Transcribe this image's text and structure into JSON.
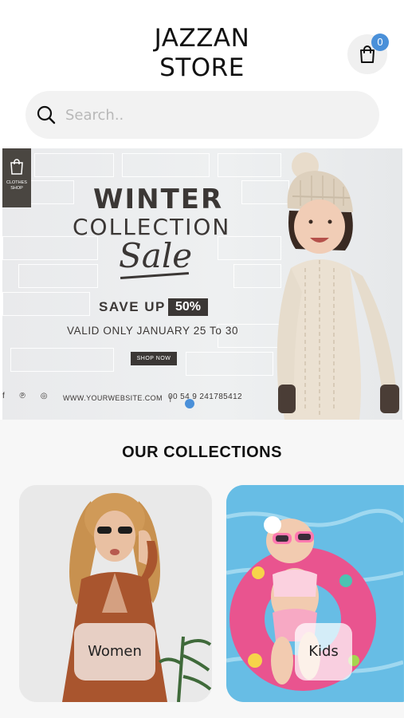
{
  "header": {
    "title_line1": "JAZZAN",
    "title_line2": "STORE",
    "cart_count": "0",
    "cart_icon": "shopping-bag-icon",
    "badge_color": "#4a90d9"
  },
  "search": {
    "placeholder": "Search..",
    "icon": "search-icon"
  },
  "banner": {
    "badge_text_line1": "CLOTHES",
    "badge_text_line2": "SHOP",
    "headline": "WINTER",
    "subheadline": "COLLECTION",
    "script_text": "Sale",
    "save_text": "SAVE UP",
    "discount": "50%",
    "valid_text": "VALID ONLY JANUARY 25 To 30",
    "cta": "SHOP NOW",
    "socials": "f  ℗  ◎",
    "website": "WWW.YOURWEBSITE.COM",
    "separator": "|",
    "phone": "00 54 9 241785412"
  },
  "collections": {
    "title": "OUR COLLECTIONS",
    "items": [
      {
        "label": "Women"
      },
      {
        "label": "Kids"
      }
    ]
  }
}
